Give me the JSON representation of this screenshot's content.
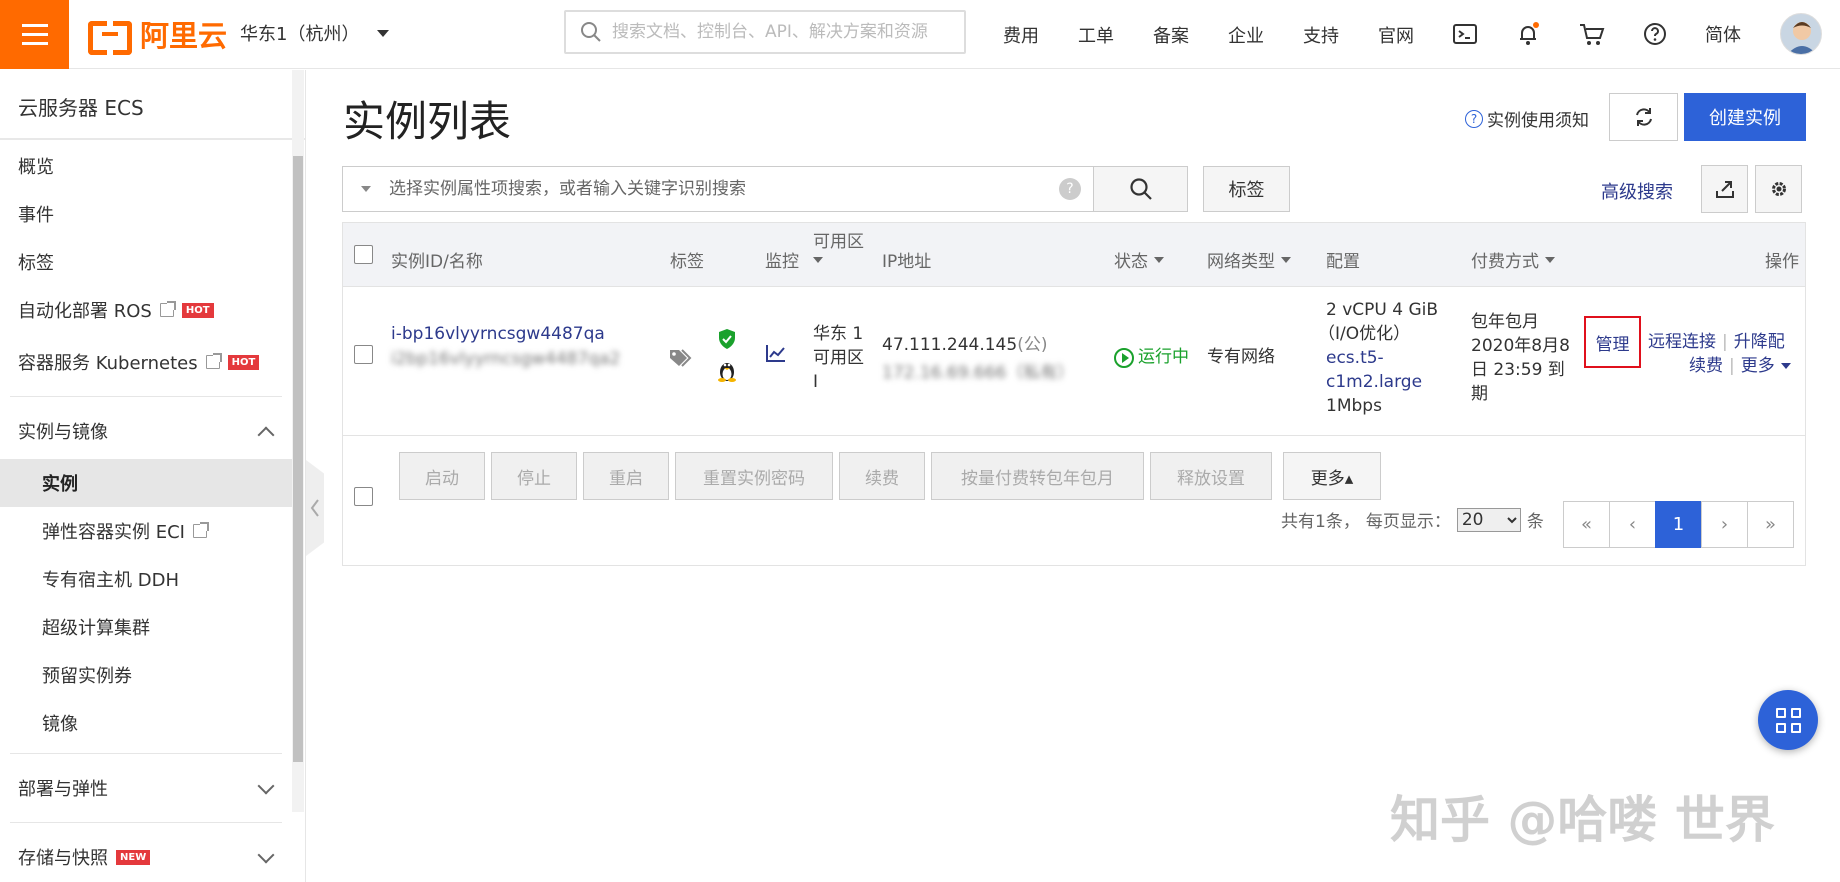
{
  "topbar": {
    "logo_text": "阿里云",
    "region": "华东1（杭州）",
    "search_placeholder": "搜索文档、控制台、API、解决方案和资源",
    "nav": [
      "费用",
      "工单",
      "备案",
      "企业",
      "支持",
      "官网"
    ],
    "lang": "简体",
    "colors": {
      "brand": "#ff6a00",
      "primary": "#2d62d8"
    }
  },
  "sidebar": {
    "title": "云服务器 ECS",
    "items": [
      {
        "label": "概览"
      },
      {
        "label": "事件"
      },
      {
        "label": "标签"
      },
      {
        "label": "自动化部署 ROS",
        "badge": "HOT"
      },
      {
        "label": "容器服务 Kubernetes",
        "badge": "HOT"
      }
    ],
    "group_instances": "实例与镜像",
    "sub_items": [
      {
        "label": "实例"
      },
      {
        "label": "弹性容器实例 ECI"
      },
      {
        "label": "专有宿主机 DDH"
      },
      {
        "label": "超级计算集群"
      },
      {
        "label": "预留实例券"
      },
      {
        "label": "镜像"
      }
    ],
    "group_deploy": "部署与弹性",
    "group_storage": "存储与快照",
    "new_badge": "NEW"
  },
  "main": {
    "title": "实例列表",
    "help_link": "实例使用须知",
    "create_button": "创建实例",
    "filter_placeholder": "选择实例属性项搜索，或者输入关键字识别搜索",
    "tag_button": "标签",
    "advanced_search": "高级搜索"
  },
  "table": {
    "headers": {
      "id": "实例ID/名称",
      "tag": "标签",
      "monitor": "监控",
      "zone": "可用区",
      "ip": "IP地址",
      "status": "状态",
      "network": "网络类型",
      "config": "配置",
      "billing": "付费方式",
      "actions": "操作"
    },
    "rows": [
      {
        "id": "i-bp16vlyyrncsgw4487qa",
        "name": "i2bp16vlyyrncsgw4487qa2",
        "zone_line1": "华东 1",
        "zone_line2": "可用区",
        "zone_line3": "I",
        "ip_public": "47.111.244.145",
        "ip_public_suffix": "(公)",
        "ip_private": "172.16.69.666（私有）",
        "status": "运行中",
        "network": "专有网络",
        "config_line1": "2 vCPU 4 GiB",
        "config_line2": "（I/O优化）",
        "config_type_line1": "ecs.t5-",
        "config_type_line2": "c1m2.large",
        "config_bandwidth": "1Mbps",
        "billing_line1": "包年包月",
        "billing_line2": "2020年8月8",
        "billing_line3": "日 23:59 到",
        "billing_line4": "期",
        "action_manage": "管理",
        "action_remote": "远程连接",
        "action_upgrade": "升降配",
        "action_renew": "续费",
        "action_more": "更多"
      }
    ]
  },
  "bulk_actions": [
    "启动",
    "停止",
    "重启",
    "重置实例密码",
    "续费",
    "按量付费转包年包月",
    "释放设置"
  ],
  "bulk_more": "更多▴",
  "pagination": {
    "total_text": "共有1条，",
    "per_page_label": "每页显示：",
    "per_page_value": "20",
    "unit": "条",
    "first": "«",
    "prev": "‹",
    "current": "1",
    "next": "›",
    "last": "»"
  },
  "watermark": "知乎 @哈喽 世界"
}
